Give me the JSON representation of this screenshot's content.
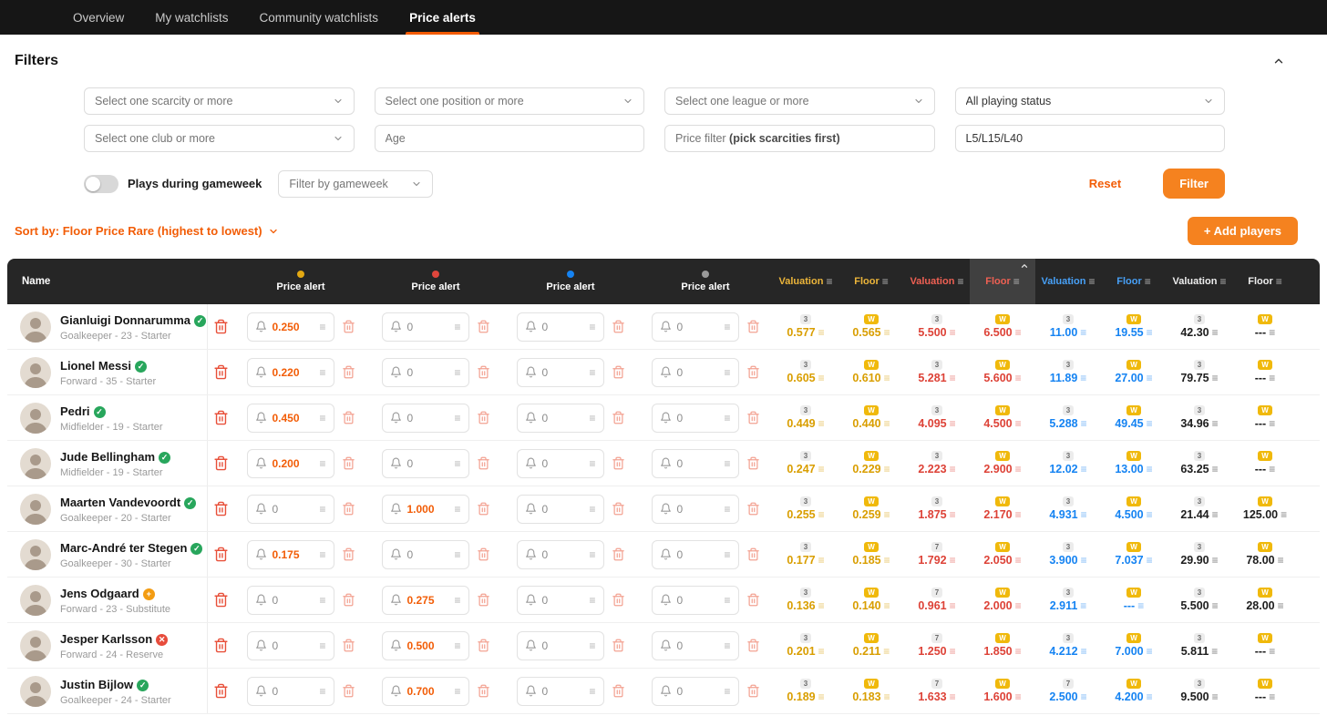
{
  "theme": {
    "nav_bg": "#161616",
    "accent_orange": "#f25d07",
    "button_orange": "#f5821f",
    "limited_yellow": "#d99e00",
    "rare_red": "#dd4237",
    "super_rare_blue": "#1583f2",
    "unique_gray": "#9a9a9a",
    "trash_red": "#e8503a",
    "trash_light_red": "#f3a393",
    "status_green": "#28a65c",
    "status_orange": "#f39c12",
    "status_red": "#e74c3c"
  },
  "nav": {
    "tabs": [
      {
        "label": "Overview"
      },
      {
        "label": "My watchlists"
      },
      {
        "label": "Community watchlists"
      },
      {
        "label": "Price alerts"
      }
    ]
  },
  "filters": {
    "title": "Filters",
    "scarcity_placeholder": "Select one scarcity or more",
    "position_placeholder": "Select one position or more",
    "league_placeholder": "Select one league or more",
    "playing_status_value": "All playing status",
    "club_placeholder": "Select one club or more",
    "age_placeholder": "Age",
    "price_filter_label": "Price filter ",
    "price_filter_bold": "(pick scarcities first)",
    "levels_value": "L5/L15/L40",
    "toggle_label": "Plays during gameweek",
    "gameweek_placeholder": "Filter by gameweek",
    "reset_label": "Reset",
    "apply_label": "Filter"
  },
  "toolbar": {
    "sort_label": "Sort by: Floor Price Rare (highest to lowest)",
    "add_players_label": "+ Add players"
  },
  "table": {
    "name_header": "Name",
    "alert_headers": [
      {
        "label": "Price alert",
        "scarcity": "limited"
      },
      {
        "label": "Price alert",
        "scarcity": "rare"
      },
      {
        "label": "Price alert",
        "scarcity": "super_rare"
      },
      {
        "label": "Price alert",
        "scarcity": "unique"
      }
    ],
    "value_headers": [
      {
        "label": "Valuation",
        "scarcity": "limited"
      },
      {
        "label": "Floor",
        "scarcity": "limited"
      },
      {
        "label": "Valuation",
        "scarcity": "rare"
      },
      {
        "label": "Floor",
        "scarcity": "rare",
        "sorted": true
      },
      {
        "label": "Valuation",
        "scarcity": "super_rare"
      },
      {
        "label": "Floor",
        "scarcity": "super_rare"
      },
      {
        "label": "Valuation",
        "scarcity": "unique"
      },
      {
        "label": "Floor",
        "scarcity": "unique"
      }
    ],
    "rows": [
      {
        "name": "Gianluigi Donnarumma",
        "status": "check",
        "meta": "Goalkeeper - 23 - Starter",
        "alerts": [
          {
            "value": "0.250"
          },
          {
            "value": "0"
          },
          {
            "value": "0"
          },
          {
            "value": "0"
          }
        ],
        "values": [
          {
            "badge": "3",
            "num": "0.577"
          },
          {
            "badge": "W",
            "num": "0.565"
          },
          {
            "badge": "3",
            "num": "5.500"
          },
          {
            "badge": "W",
            "num": "6.500"
          },
          {
            "badge": "3",
            "num": "11.00"
          },
          {
            "badge": "W",
            "num": "19.55"
          },
          {
            "badge": "3",
            "num": "42.30"
          },
          {
            "badge": "W",
            "num": "---"
          }
        ]
      },
      {
        "name": "Lionel Messi",
        "status": "check",
        "meta": "Forward - 35 - Starter",
        "alerts": [
          {
            "value": "0.220"
          },
          {
            "value": "0"
          },
          {
            "value": "0"
          },
          {
            "value": "0"
          }
        ],
        "values": [
          {
            "badge": "3",
            "num": "0.605"
          },
          {
            "badge": "W",
            "num": "0.610"
          },
          {
            "badge": "3",
            "num": "5.281"
          },
          {
            "badge": "W",
            "num": "5.600"
          },
          {
            "badge": "3",
            "num": "11.89"
          },
          {
            "badge": "W",
            "num": "27.00"
          },
          {
            "badge": "3",
            "num": "79.75"
          },
          {
            "badge": "W",
            "num": "---"
          }
        ]
      },
      {
        "name": "Pedri",
        "status": "check",
        "meta": "Midfielder - 19 - Starter",
        "alerts": [
          {
            "value": "0.450"
          },
          {
            "value": "0"
          },
          {
            "value": "0"
          },
          {
            "value": "0"
          }
        ],
        "values": [
          {
            "badge": "3",
            "num": "0.449"
          },
          {
            "badge": "W",
            "num": "0.440"
          },
          {
            "badge": "3",
            "num": "4.095"
          },
          {
            "badge": "W",
            "num": "4.500"
          },
          {
            "badge": "3",
            "num": "5.288"
          },
          {
            "badge": "W",
            "num": "49.45"
          },
          {
            "badge": "3",
            "num": "34.96"
          },
          {
            "badge": "W",
            "num": "---"
          }
        ]
      },
      {
        "name": "Jude Bellingham",
        "status": "check",
        "meta": "Midfielder - 19 - Starter",
        "alerts": [
          {
            "value": "0.200"
          },
          {
            "value": "0"
          },
          {
            "value": "0"
          },
          {
            "value": "0"
          }
        ],
        "values": [
          {
            "badge": "3",
            "num": "0.247"
          },
          {
            "badge": "W",
            "num": "0.229"
          },
          {
            "badge": "3",
            "num": "2.223"
          },
          {
            "badge": "W",
            "num": "2.900"
          },
          {
            "badge": "3",
            "num": "12.02"
          },
          {
            "badge": "W",
            "num": "13.00"
          },
          {
            "badge": "3",
            "num": "63.25"
          },
          {
            "badge": "W",
            "num": "---"
          }
        ]
      },
      {
        "name": "Maarten Vandevoordt",
        "status": "check",
        "meta": "Goalkeeper - 20 - Starter",
        "alerts": [
          {
            "value": "0"
          },
          {
            "value": "1.000"
          },
          {
            "value": "0"
          },
          {
            "value": "0"
          }
        ],
        "values": [
          {
            "badge": "3",
            "num": "0.255"
          },
          {
            "badge": "W",
            "num": "0.259"
          },
          {
            "badge": "3",
            "num": "1.875"
          },
          {
            "badge": "W",
            "num": "2.170"
          },
          {
            "badge": "3",
            "num": "4.931"
          },
          {
            "badge": "W",
            "num": "4.500"
          },
          {
            "badge": "3",
            "num": "21.44"
          },
          {
            "badge": "W",
            "num": "125.00"
          }
        ]
      },
      {
        "name": "Marc-André ter Stegen",
        "status": "check",
        "meta": "Goalkeeper - 30 - Starter",
        "alerts": [
          {
            "value": "0.175"
          },
          {
            "value": "0"
          },
          {
            "value": "0"
          },
          {
            "value": "0"
          }
        ],
        "values": [
          {
            "badge": "3",
            "num": "0.177"
          },
          {
            "badge": "W",
            "num": "0.185"
          },
          {
            "badge": "7",
            "num": "1.792"
          },
          {
            "badge": "W",
            "num": "2.050"
          },
          {
            "badge": "3",
            "num": "3.900"
          },
          {
            "badge": "W",
            "num": "7.037"
          },
          {
            "badge": "3",
            "num": "29.90"
          },
          {
            "badge": "W",
            "num": "78.00"
          }
        ]
      },
      {
        "name": "Jens Odgaard",
        "status": "plus",
        "meta": "Forward - 23 - Substitute",
        "alerts": [
          {
            "value": "0"
          },
          {
            "value": "0.275"
          },
          {
            "value": "0"
          },
          {
            "value": "0"
          }
        ],
        "values": [
          {
            "badge": "3",
            "num": "0.136"
          },
          {
            "badge": "W",
            "num": "0.140"
          },
          {
            "badge": "7",
            "num": "0.961"
          },
          {
            "badge": "W",
            "num": "2.000"
          },
          {
            "badge": "3",
            "num": "2.911"
          },
          {
            "badge": "W",
            "num": "---"
          },
          {
            "badge": "3",
            "num": "5.500"
          },
          {
            "badge": "W",
            "num": "28.00"
          }
        ]
      },
      {
        "name": "Jesper Karlsson",
        "status": "cross",
        "meta": "Forward - 24 - Reserve",
        "alerts": [
          {
            "value": "0"
          },
          {
            "value": "0.500"
          },
          {
            "value": "0"
          },
          {
            "value": "0"
          }
        ],
        "values": [
          {
            "badge": "3",
            "num": "0.201"
          },
          {
            "badge": "W",
            "num": "0.211"
          },
          {
            "badge": "7",
            "num": "1.250"
          },
          {
            "badge": "W",
            "num": "1.850"
          },
          {
            "badge": "3",
            "num": "4.212"
          },
          {
            "badge": "W",
            "num": "7.000"
          },
          {
            "badge": "3",
            "num": "5.811"
          },
          {
            "badge": "W",
            "num": "---"
          }
        ]
      },
      {
        "name": "Justin Bijlow",
        "status": "check",
        "meta": "Goalkeeper - 24 - Starter",
        "alerts": [
          {
            "value": "0"
          },
          {
            "value": "0.700"
          },
          {
            "value": "0"
          },
          {
            "value": "0"
          }
        ],
        "values": [
          {
            "badge": "3",
            "num": "0.189"
          },
          {
            "badge": "W",
            "num": "0.183"
          },
          {
            "badge": "7",
            "num": "1.633"
          },
          {
            "badge": "W",
            "num": "1.600"
          },
          {
            "badge": "7",
            "num": "2.500"
          },
          {
            "badge": "W",
            "num": "4.200"
          },
          {
            "badge": "3",
            "num": "9.500"
          },
          {
            "badge": "W",
            "num": "---"
          }
        ]
      }
    ]
  },
  "icons": {
    "status_glyphs": {
      "check": "✓",
      "plus": "+",
      "cross": "✕"
    }
  }
}
